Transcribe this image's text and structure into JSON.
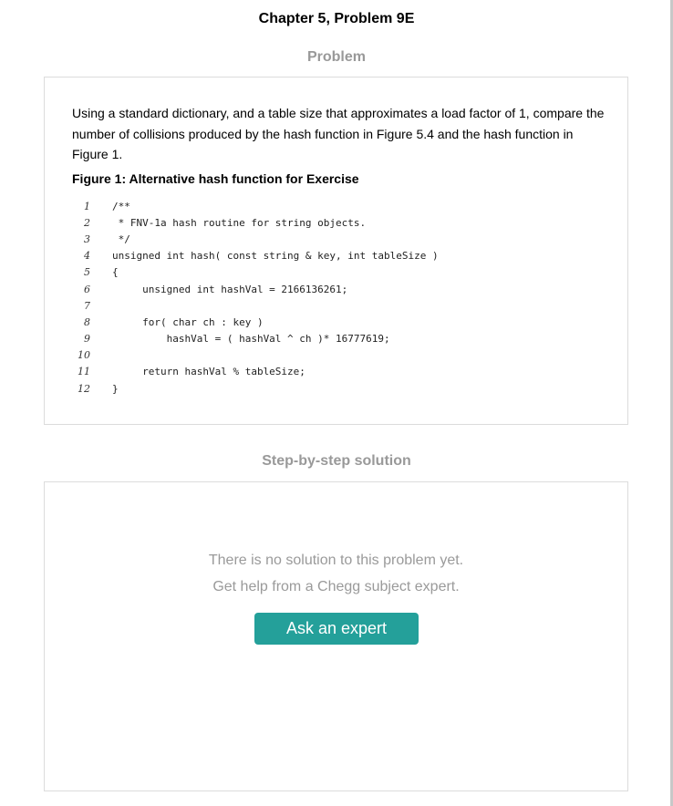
{
  "header": {
    "chapter_title": "Chapter 5, Problem 9E"
  },
  "problem": {
    "heading": "Problem",
    "text": "Using a standard dictionary, and a table size that approximates a load factor of 1, compare the number of collisions produced by the hash function in Figure 5.4 and the hash function in Figure 1.",
    "figure_caption": "Figure 1: Alternative hash function for Exercise",
    "code_lines": [
      {
        "num": "1",
        "code": "/**"
      },
      {
        "num": "2",
        "code": " * FNV-1a hash routine for string objects."
      },
      {
        "num": "3",
        "code": " */"
      },
      {
        "num": "4",
        "code": "unsigned int hash( const string & key, int tableSize )"
      },
      {
        "num": "5",
        "code": "{"
      },
      {
        "num": "6",
        "code": "     unsigned int hashVal = 2166136261;"
      },
      {
        "num": "7",
        "code": ""
      },
      {
        "num": "8",
        "code": "     for( char ch : key )"
      },
      {
        "num": "9",
        "code": "         hashVal = ( hashVal ^ ch )* 16777619;"
      },
      {
        "num": "10",
        "code": ""
      },
      {
        "num": "11",
        "code": "     return hashVal % tableSize;"
      },
      {
        "num": "12",
        "code": "}"
      }
    ]
  },
  "solution": {
    "heading": "Step-by-step solution",
    "no_solution_line1": "There is no solution to this problem yet.",
    "no_solution_line2": "Get help from a Chegg subject expert.",
    "ask_button_label": "Ask an expert"
  },
  "colors": {
    "button_bg": "#24a09a",
    "heading_gray": "#999999"
  }
}
